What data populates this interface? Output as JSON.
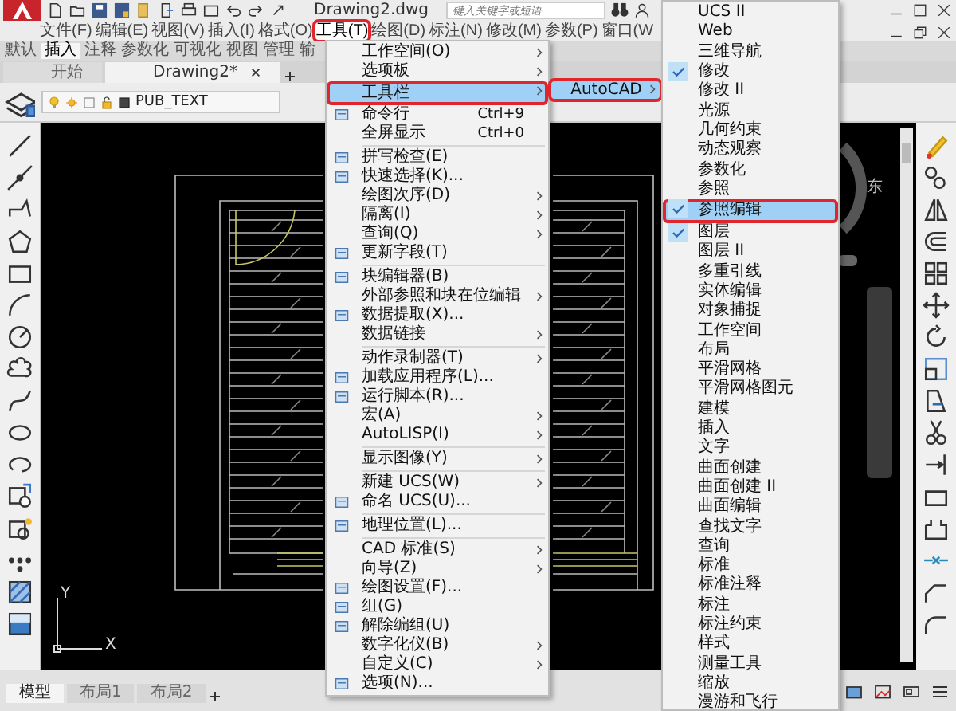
{
  "title_bar": {
    "document": "Drawing2.dwg",
    "search": {
      "placeholder": "键入关键字或短语"
    }
  },
  "menu_bar": [
    {
      "label": "文件(F)",
      "selected": false,
      "highlighted": false
    },
    {
      "label": "编辑(E)",
      "selected": false,
      "highlighted": false
    },
    {
      "label": "视图(V)",
      "selected": false,
      "highlighted": false
    },
    {
      "label": "插入(I)",
      "selected": false,
      "highlighted": false
    },
    {
      "label": "格式(O)",
      "selected": false,
      "highlighted": false
    },
    {
      "label": "工具(T)",
      "selected": true,
      "highlighted": true
    },
    {
      "label": "绘图(D)",
      "selected": false,
      "highlighted": false
    },
    {
      "label": "标注(N)",
      "selected": false,
      "highlighted": false
    },
    {
      "label": "修改(M)",
      "selected": false,
      "highlighted": false
    },
    {
      "label": "参数(P)",
      "selected": false,
      "highlighted": false
    },
    {
      "label": "窗口(W",
      "selected": false,
      "highlighted": false
    }
  ],
  "ribbon_tabs": [
    {
      "label": "默认",
      "selected": false
    },
    {
      "label": "插入",
      "selected": true
    },
    {
      "label": "注释",
      "selected": false
    },
    {
      "label": "参数化",
      "selected": false
    },
    {
      "label": "可视化",
      "selected": false
    },
    {
      "label": "视图",
      "selected": false
    },
    {
      "label": "管理",
      "selected": false
    },
    {
      "label": "输",
      "selected": false
    }
  ],
  "document_tabs": [
    {
      "label": "开始",
      "selected": false,
      "closable": false
    },
    {
      "label": "Drawing2*",
      "selected": true,
      "closable": true
    }
  ],
  "layer_bar": {
    "layer": "PUB_TEXT"
  },
  "tools_menu": {
    "items": [
      {
        "kind": "item",
        "label": "工作空间(O)",
        "submenu": true,
        "icon": false,
        "selected": false,
        "highlighted": false
      },
      {
        "kind": "item",
        "label": "选项板",
        "submenu": true,
        "icon": false,
        "selected": false,
        "highlighted": false
      },
      {
        "kind": "item",
        "label": "工具栏",
        "submenu": true,
        "icon": false,
        "selected": true,
        "highlighted": true
      },
      {
        "kind": "item",
        "label": "命令行",
        "shortcut": "Ctrl+9",
        "submenu": false,
        "icon": true,
        "selected": false,
        "highlighted": false
      },
      {
        "kind": "item",
        "label": "全屏显示",
        "shortcut": "Ctrl+0",
        "submenu": false,
        "icon": false,
        "selected": false,
        "highlighted": false
      },
      {
        "kind": "separator"
      },
      {
        "kind": "item",
        "label": "拼写检查(E)",
        "submenu": false,
        "icon": true,
        "selected": false,
        "highlighted": false
      },
      {
        "kind": "item",
        "label": "快速选择(K)...",
        "submenu": false,
        "icon": true,
        "selected": false,
        "highlighted": false
      },
      {
        "kind": "item",
        "label": "绘图次序(D)",
        "submenu": true,
        "icon": false,
        "selected": false,
        "highlighted": false
      },
      {
        "kind": "item",
        "label": "隔离(I)",
        "submenu": true,
        "icon": false,
        "selected": false,
        "highlighted": false
      },
      {
        "kind": "item",
        "label": "查询(Q)",
        "submenu": true,
        "icon": false,
        "selected": false,
        "highlighted": false
      },
      {
        "kind": "item",
        "label": "更新字段(T)",
        "submenu": false,
        "icon": true,
        "selected": false,
        "highlighted": false
      },
      {
        "kind": "separator"
      },
      {
        "kind": "item",
        "label": "块编辑器(B)",
        "submenu": false,
        "icon": true,
        "selected": false,
        "highlighted": false
      },
      {
        "kind": "item",
        "label": "外部参照和块在位编辑",
        "submenu": true,
        "icon": false,
        "selected": false,
        "highlighted": false
      },
      {
        "kind": "item",
        "label": "数据提取(X)...",
        "submenu": false,
        "icon": true,
        "selected": false,
        "highlighted": false
      },
      {
        "kind": "item",
        "label": "数据链接",
        "submenu": true,
        "icon": false,
        "selected": false,
        "highlighted": false
      },
      {
        "kind": "separator"
      },
      {
        "kind": "item",
        "label": "动作录制器(T)",
        "submenu": true,
        "icon": false,
        "selected": false,
        "highlighted": false
      },
      {
        "kind": "item",
        "label": "加载应用程序(L)...",
        "submenu": false,
        "icon": true,
        "selected": false,
        "highlighted": false
      },
      {
        "kind": "item",
        "label": "运行脚本(R)...",
        "submenu": false,
        "icon": true,
        "selected": false,
        "highlighted": false
      },
      {
        "kind": "item",
        "label": "宏(A)",
        "submenu": true,
        "icon": false,
        "selected": false,
        "highlighted": false
      },
      {
        "kind": "item",
        "label": "AutoLISP(I)",
        "submenu": true,
        "icon": false,
        "selected": false,
        "highlighted": false
      },
      {
        "kind": "separator"
      },
      {
        "kind": "item",
        "label": "显示图像(Y)",
        "submenu": true,
        "icon": false,
        "selected": false,
        "highlighted": false
      },
      {
        "kind": "separator"
      },
      {
        "kind": "item",
        "label": "新建 UCS(W)",
        "submenu": true,
        "icon": false,
        "selected": false,
        "highlighted": false
      },
      {
        "kind": "item",
        "label": "命名 UCS(U)...",
        "submenu": false,
        "icon": true,
        "selected": false,
        "highlighted": false
      },
      {
        "kind": "separator"
      },
      {
        "kind": "item",
        "label": "地理位置(L)...",
        "submenu": false,
        "icon": true,
        "selected": false,
        "highlighted": false
      },
      {
        "kind": "separator"
      },
      {
        "kind": "item",
        "label": "CAD 标准(S)",
        "submenu": true,
        "icon": false,
        "selected": false,
        "highlighted": false
      },
      {
        "kind": "item",
        "label": "向导(Z)",
        "submenu": true,
        "icon": false,
        "selected": false,
        "highlighted": false
      },
      {
        "kind": "item",
        "label": "绘图设置(F)...",
        "submenu": false,
        "icon": true,
        "selected": false,
        "highlighted": false
      },
      {
        "kind": "item",
        "label": "组(G)",
        "submenu": false,
        "icon": true,
        "selected": false,
        "highlighted": false
      },
      {
        "kind": "item",
        "label": "解除编组(U)",
        "submenu": false,
        "icon": true,
        "selected": false,
        "highlighted": false
      },
      {
        "kind": "item",
        "label": "数字化仪(B)",
        "submenu": true,
        "icon": false,
        "selected": false,
        "highlighted": false
      },
      {
        "kind": "item",
        "label": "自定义(C)",
        "submenu": true,
        "icon": false,
        "selected": false,
        "highlighted": false
      },
      {
        "kind": "item",
        "label": "选项(N)...",
        "submenu": false,
        "icon": true,
        "selected": false,
        "highlighted": false
      }
    ]
  },
  "toolbar_submenu": {
    "label": "AutoCAD",
    "submenu": true,
    "selected": true,
    "highlighted": true
  },
  "autocad_toolbars": [
    {
      "label": "UCS II",
      "checked": false,
      "selected": false,
      "highlighted": false
    },
    {
      "label": "Web",
      "checked": false,
      "selected": false,
      "highlighted": false
    },
    {
      "label": "三维导航",
      "checked": false,
      "selected": false,
      "highlighted": false
    },
    {
      "label": "修改",
      "checked": true,
      "selected": false,
      "highlighted": false
    },
    {
      "label": "修改 II",
      "checked": false,
      "selected": false,
      "highlighted": false
    },
    {
      "label": "光源",
      "checked": false,
      "selected": false,
      "highlighted": false
    },
    {
      "label": "几何约束",
      "checked": false,
      "selected": false,
      "highlighted": false
    },
    {
      "label": "动态观察",
      "checked": false,
      "selected": false,
      "highlighted": false
    },
    {
      "label": "参数化",
      "checked": false,
      "selected": false,
      "highlighted": false
    },
    {
      "label": "参照",
      "checked": false,
      "selected": false,
      "highlighted": false
    },
    {
      "label": "参照编辑",
      "checked": true,
      "selected": true,
      "highlighted": true
    },
    {
      "label": "图层",
      "checked": true,
      "selected": false,
      "highlighted": false
    },
    {
      "label": "图层 II",
      "checked": false,
      "selected": false,
      "highlighted": false
    },
    {
      "label": "多重引线",
      "checked": false,
      "selected": false,
      "highlighted": false
    },
    {
      "label": "实体编辑",
      "checked": false,
      "selected": false,
      "highlighted": false
    },
    {
      "label": "对象捕捉",
      "checked": false,
      "selected": false,
      "highlighted": false
    },
    {
      "label": "工作空间",
      "checked": false,
      "selected": false,
      "highlighted": false
    },
    {
      "label": "布局",
      "checked": false,
      "selected": false,
      "highlighted": false
    },
    {
      "label": "平滑网格",
      "checked": false,
      "selected": false,
      "highlighted": false
    },
    {
      "label": "平滑网格图元",
      "checked": false,
      "selected": false,
      "highlighted": false
    },
    {
      "label": "建模",
      "checked": false,
      "selected": false,
      "highlighted": false
    },
    {
      "label": "插入",
      "checked": false,
      "selected": false,
      "highlighted": false
    },
    {
      "label": "文字",
      "checked": false,
      "selected": false,
      "highlighted": false
    },
    {
      "label": "曲面创建",
      "checked": false,
      "selected": false,
      "highlighted": false
    },
    {
      "label": "曲面创建 II",
      "checked": false,
      "selected": false,
      "highlighted": false
    },
    {
      "label": "曲面编辑",
      "checked": false,
      "selected": false,
      "highlighted": false
    },
    {
      "label": "查找文字",
      "checked": false,
      "selected": false,
      "highlighted": false
    },
    {
      "label": "查询",
      "checked": false,
      "selected": false,
      "highlighted": false
    },
    {
      "label": "标准",
      "checked": false,
      "selected": false,
      "highlighted": false
    },
    {
      "label": "标准注释",
      "checked": false,
      "selected": false,
      "highlighted": false
    },
    {
      "label": "标注",
      "checked": false,
      "selected": false,
      "highlighted": false
    },
    {
      "label": "标注约束",
      "checked": false,
      "selected": false,
      "highlighted": false
    },
    {
      "label": "样式",
      "checked": false,
      "selected": false,
      "highlighted": false
    },
    {
      "label": "测量工具",
      "checked": false,
      "selected": false,
      "highlighted": false
    },
    {
      "label": "缩放",
      "checked": false,
      "selected": false,
      "highlighted": false
    },
    {
      "label": "漫游和飞行",
      "checked": false,
      "selected": false,
      "highlighted": false
    }
  ],
  "view_cube": {
    "direction": "东"
  },
  "ucs_icon": {
    "x_label": "X",
    "y_label": "Y"
  },
  "layout_tabs": [
    {
      "label": "模型",
      "selected": true
    },
    {
      "label": "布局1",
      "selected": false
    },
    {
      "label": "布局2",
      "selected": false
    }
  ]
}
